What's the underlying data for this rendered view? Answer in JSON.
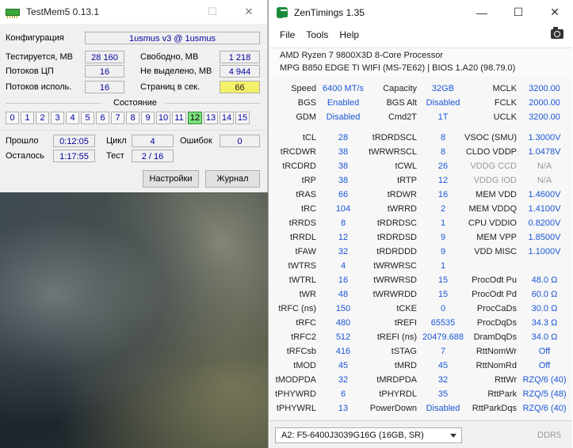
{
  "testmem": {
    "title": "TestMem5  0.13.1",
    "config_label": "Конфигурация",
    "config_value": "1usmus v3 @ 1usmus",
    "tested_label": "Тестируется, МВ",
    "tested_value": "28 160",
    "free_label": "Свободно, МВ",
    "free_value": "1 218",
    "cpu_threads_label": "Потоков ЦП",
    "cpu_threads_value": "16",
    "unallocated_label": "Не выделено, МВ",
    "unallocated_value": "4 944",
    "threads_used_label": "Потоков исполь.",
    "threads_used_value": "16",
    "pages_label": "Страниц в сек.",
    "pages_value": "66",
    "state_label": "Состояние",
    "threads": [
      "0",
      "1",
      "2",
      "3",
      "4",
      "5",
      "6",
      "7",
      "8",
      "9",
      "10",
      "11",
      "12",
      "13",
      "14",
      "15"
    ],
    "active_thread": "12",
    "elapsed_label": "Прошло",
    "elapsed_value": "0:12:05",
    "cycle_label": "Цикл",
    "cycle_value": "4",
    "errors_label": "Ошибок",
    "errors_value": "0",
    "remaining_label": "Осталось",
    "remaining_value": "1:17:55",
    "test_label": "Тест",
    "test_value": "2 / 16",
    "settings_button": "Настройки",
    "log_button": "Журнал"
  },
  "zentimings": {
    "title": "ZenTimings 1.35",
    "menu": [
      "File",
      "Tools",
      "Help"
    ],
    "cpu": "AMD Ryzen 7 9800X3D 8-Core Processor",
    "board": "MPG B850 EDGE TI WIFI (MS-7E62) | BIOS 1.A20 (98.79.0)",
    "top": [
      [
        [
          "Speed",
          "6400 MT/s"
        ],
        [
          "Capacity",
          "32GB"
        ],
        [
          "MCLK",
          "3200.00"
        ]
      ],
      [
        [
          "BGS",
          "Enabled"
        ],
        [
          "BGS Alt",
          "Disabled"
        ],
        [
          "FCLK",
          "2000.00"
        ]
      ],
      [
        [
          "GDM",
          "Disabled"
        ],
        [
          "Cmd2T",
          "1T"
        ],
        [
          "UCLK",
          "3200.00"
        ]
      ]
    ],
    "timings": [
      [
        [
          "tCL",
          "28"
        ],
        [
          "tRDRDSCL",
          "8"
        ],
        [
          "VSOC (SMU)",
          "1.3000V"
        ]
      ],
      [
        [
          "tRCDWR",
          "38"
        ],
        [
          "tWRWRSCL",
          "8"
        ],
        [
          "CLDO VDDP",
          "1.0478V"
        ]
      ],
      [
        [
          "tRCDRD",
          "38"
        ],
        [
          "tCWL",
          "26"
        ],
        [
          "VDDG CCD",
          "N/A"
        ]
      ],
      [
        [
          "tRP",
          "38"
        ],
        [
          "tRTP",
          "12"
        ],
        [
          "VDDG IOD",
          "N/A"
        ]
      ],
      [
        [
          "tRAS",
          "66"
        ],
        [
          "tRDWR",
          "16"
        ],
        [
          "MEM VDD",
          "1.4600V"
        ]
      ],
      [
        [
          "tRC",
          "104"
        ],
        [
          "tWRRD",
          "2"
        ],
        [
          "MEM VDDQ",
          "1.4100V"
        ]
      ],
      [
        [
          "tRRDS",
          "8"
        ],
        [
          "tRDRDSC",
          "1"
        ],
        [
          "CPU VDDIO",
          "0.8200V"
        ]
      ],
      [
        [
          "tRRDL",
          "12"
        ],
        [
          "tRDRDSD",
          "9"
        ],
        [
          "MEM VPP",
          "1.8500V"
        ]
      ],
      [
        [
          "tFAW",
          "32"
        ],
        [
          "tRDRDDD",
          "9"
        ],
        [
          "VDD MISC",
          "1.1000V"
        ]
      ],
      [
        [
          "tWTRS",
          "4"
        ],
        [
          "tWRWRSC",
          "1"
        ],
        [
          "",
          ""
        ]
      ],
      [
        [
          "tWTRL",
          "16"
        ],
        [
          "tWRWRSD",
          "15"
        ],
        [
          "ProcOdt Pu",
          "48.0 Ω"
        ]
      ],
      [
        [
          "tWR",
          "48"
        ],
        [
          "tWRWRDD",
          "15"
        ],
        [
          "ProcOdt Pd",
          "60.0 Ω"
        ]
      ],
      [
        [
          "tRFC (ns)",
          "150"
        ],
        [
          "tCKE",
          "0"
        ],
        [
          "ProcCaDs",
          "30.0 Ω"
        ]
      ],
      [
        [
          "tRFC",
          "480"
        ],
        [
          "tREFI",
          "65535"
        ],
        [
          "ProcDqDs",
          "34.3 Ω"
        ]
      ],
      [
        [
          "tRFC2",
          "512"
        ],
        [
          "tREFI (ns)",
          "20479.688"
        ],
        [
          "DramDqDs",
          "34.0 Ω"
        ]
      ],
      [
        [
          "tRFCsb",
          "416"
        ],
        [
          "tSTAG",
          "7"
        ],
        [
          "RttNomWr",
          "Off"
        ]
      ],
      [
        [
          "tMOD",
          "45"
        ],
        [
          "tMRD",
          "45"
        ],
        [
          "RttNomRd",
          "Off"
        ]
      ],
      [
        [
          "tMODPDA",
          "32"
        ],
        [
          "tMRDPDA",
          "32"
        ],
        [
          "RttWr",
          "RZQ/6 (40)"
        ]
      ],
      [
        [
          "tPHYWRD",
          "6"
        ],
        [
          "tPHYRDL",
          "35"
        ],
        [
          "RttPark",
          "RZQ/5 (48)"
        ]
      ],
      [
        [
          "tPHYWRL",
          "13"
        ],
        [
          "PowerDown",
          "Disabled"
        ],
        [
          "RttParkDqs",
          "RZQ/6 (40)"
        ]
      ]
    ],
    "dim_labels": [
      "VDDG CCD",
      "VDDG IOD"
    ],
    "dimm_select": "A2: F5-6400J3039G16G (16GB, SR)",
    "ddr_label": "DDR5"
  }
}
